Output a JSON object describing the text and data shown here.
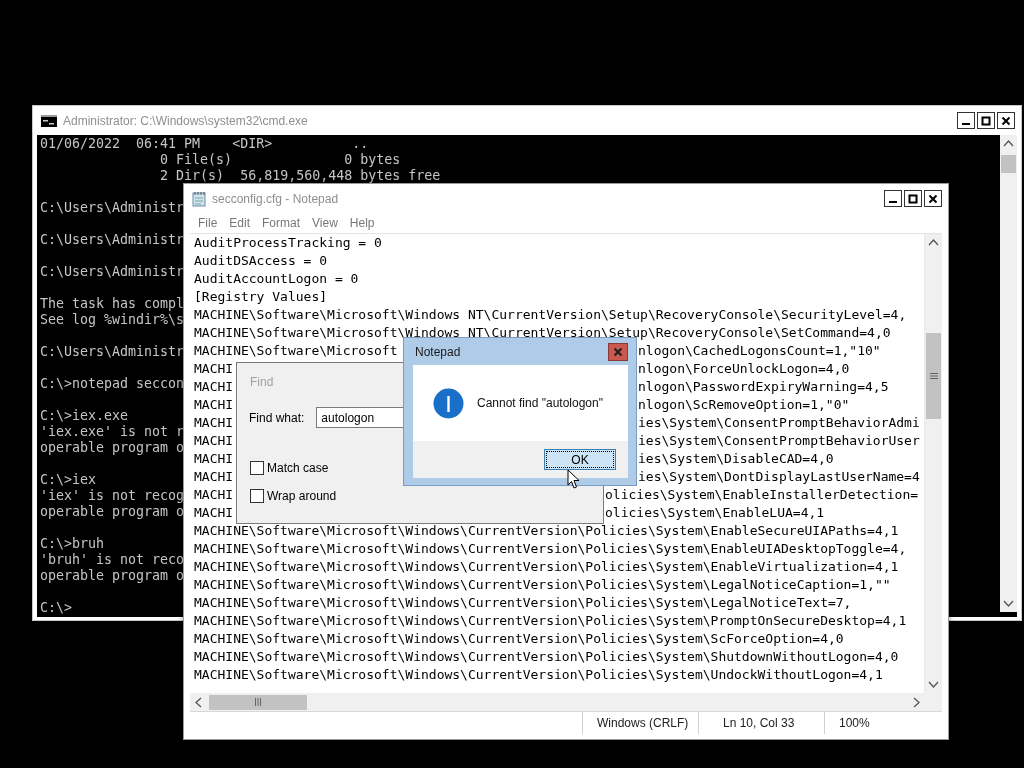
{
  "cmd_window": {
    "title": "Administrator: C:\\Windows\\system32\\cmd.exe",
    "blocks": [
      [
        "01/06/2022  06:41 PM    <DIR>          ..",
        "               0 File(s)              0 bytes",
        "               2 Dir(s)  56,819,560,448 bytes free"
      ],
      [
        "C:\\Users\\Administr"
      ],
      [
        "C:\\Users\\Administr"
      ],
      [
        "C:\\Users\\Administr"
      ],
      [
        "The task has compl",
        "See log %windir%\\s"
      ],
      [
        "C:\\Users\\Administr"
      ],
      [
        "C:\\>notepad seccon"
      ],
      [
        "C:\\>iex.exe",
        "'iex.exe' is not r",
        "operable program o"
      ],
      [
        "C:\\>iex",
        "'iex' is not recog",
        "operable program o"
      ],
      [
        "C:\\>bruh",
        "'bruh' is not reco",
        "operable program o"
      ],
      [
        "C:\\>"
      ]
    ]
  },
  "notepad": {
    "title": "secconfig.cfg - Notepad",
    "menu": [
      "File",
      "Edit",
      "Format",
      "View",
      "Help"
    ],
    "lines": [
      {
        "text": "AuditProcessTracking = 0"
      },
      {
        "text": "AuditDSAccess = 0"
      },
      {
        "text": "AuditAccountLogon = 0"
      },
      {
        "text": "[Registry Values]"
      },
      {
        "text": "MACHINE\\Software\\Microsoft\\Windows NT\\CurrentVersion\\Setup\\RecoveryConsole\\SecurityLevel=4,"
      },
      {
        "text": "MACHINE\\Software\\Microsoft\\Windows NT\\CurrentVersion\\Setup\\RecoveryConsole\\SetCommand=4,0"
      },
      {
        "text": "MACHINE\\Software\\Microsoft",
        "tail": "nlogon\\CachedLogonsCount=1,\"10\""
      },
      {
        "text": "MACHI",
        "tail": "nlogon\\ForceUnlockLogon=4,0"
      },
      {
        "text": "MACHI",
        "tail": "nlogon\\PasswordExpiryWarning=4,5"
      },
      {
        "text": "MACHI",
        "tail": "nlogon\\ScRemoveOption=1,\"0\""
      },
      {
        "text": "MACHI",
        "tail": "ies\\System\\ConsentPromptBehaviorAdmi"
      },
      {
        "text": "MACHI",
        "tail": "ies\\System\\ConsentPromptBehaviorUser"
      },
      {
        "text": "MACHI",
        "tail": "ies\\System\\DisableCAD=4,0"
      },
      {
        "text": "MACHI",
        "tail": "ies\\System\\DontDisplayLastUserName=4"
      },
      {
        "text": "MACHI",
        "tail": "olicies\\System\\EnableInstallerDetection="
      },
      {
        "text": "MACHI",
        "tail": "olicies\\System\\EnableLUA=4,1"
      },
      {
        "text": "MACHINE\\Software\\Microsoft\\Windows\\CurrentVersion\\Policies\\System\\EnableSecureUIAPaths=4,1"
      },
      {
        "text": "MACHINE\\Software\\Microsoft\\Windows\\CurrentVersion\\Policies\\System\\EnableUIADesktopToggle=4,"
      },
      {
        "text": "MACHINE\\Software\\Microsoft\\Windows\\CurrentVersion\\Policies\\System\\EnableVirtualization=4,1"
      },
      {
        "text": "MACHINE\\Software\\Microsoft\\Windows\\CurrentVersion\\Policies\\System\\LegalNoticeCaption=1,\"\""
      },
      {
        "text": "MACHINE\\Software\\Microsoft\\Windows\\CurrentVersion\\Policies\\System\\LegalNoticeText=7,"
      },
      {
        "text": "MACHINE\\Software\\Microsoft\\Windows\\CurrentVersion\\Policies\\System\\PromptOnSecureDesktop=4,1"
      },
      {
        "text": "MACHINE\\Software\\Microsoft\\Windows\\CurrentVersion\\Policies\\System\\ScForceOption=4,0"
      },
      {
        "text": "MACHINE\\Software\\Microsoft\\Windows\\CurrentVersion\\Policies\\System\\ShutdownWithoutLogon=4,0"
      },
      {
        "text": "MACHINE\\Software\\Microsoft\\Windows\\CurrentVersion\\Policies\\System\\UndockWithoutLogon=4,1"
      }
    ],
    "status_bar": {
      "line_ending": "Windows (CRLF)",
      "position": "Ln 10, Col 33",
      "zoom": "100%"
    }
  },
  "find_dialog": {
    "title": "Find",
    "find_what_label": "Find what:",
    "find_what_value": "autologon",
    "options": [
      {
        "label": "Match case",
        "checked": false
      },
      {
        "label": "Wrap around",
        "checked": false
      }
    ]
  },
  "message_box": {
    "title": "Notepad",
    "message": "Cannot find \"autologon\"",
    "button": "OK"
  }
}
